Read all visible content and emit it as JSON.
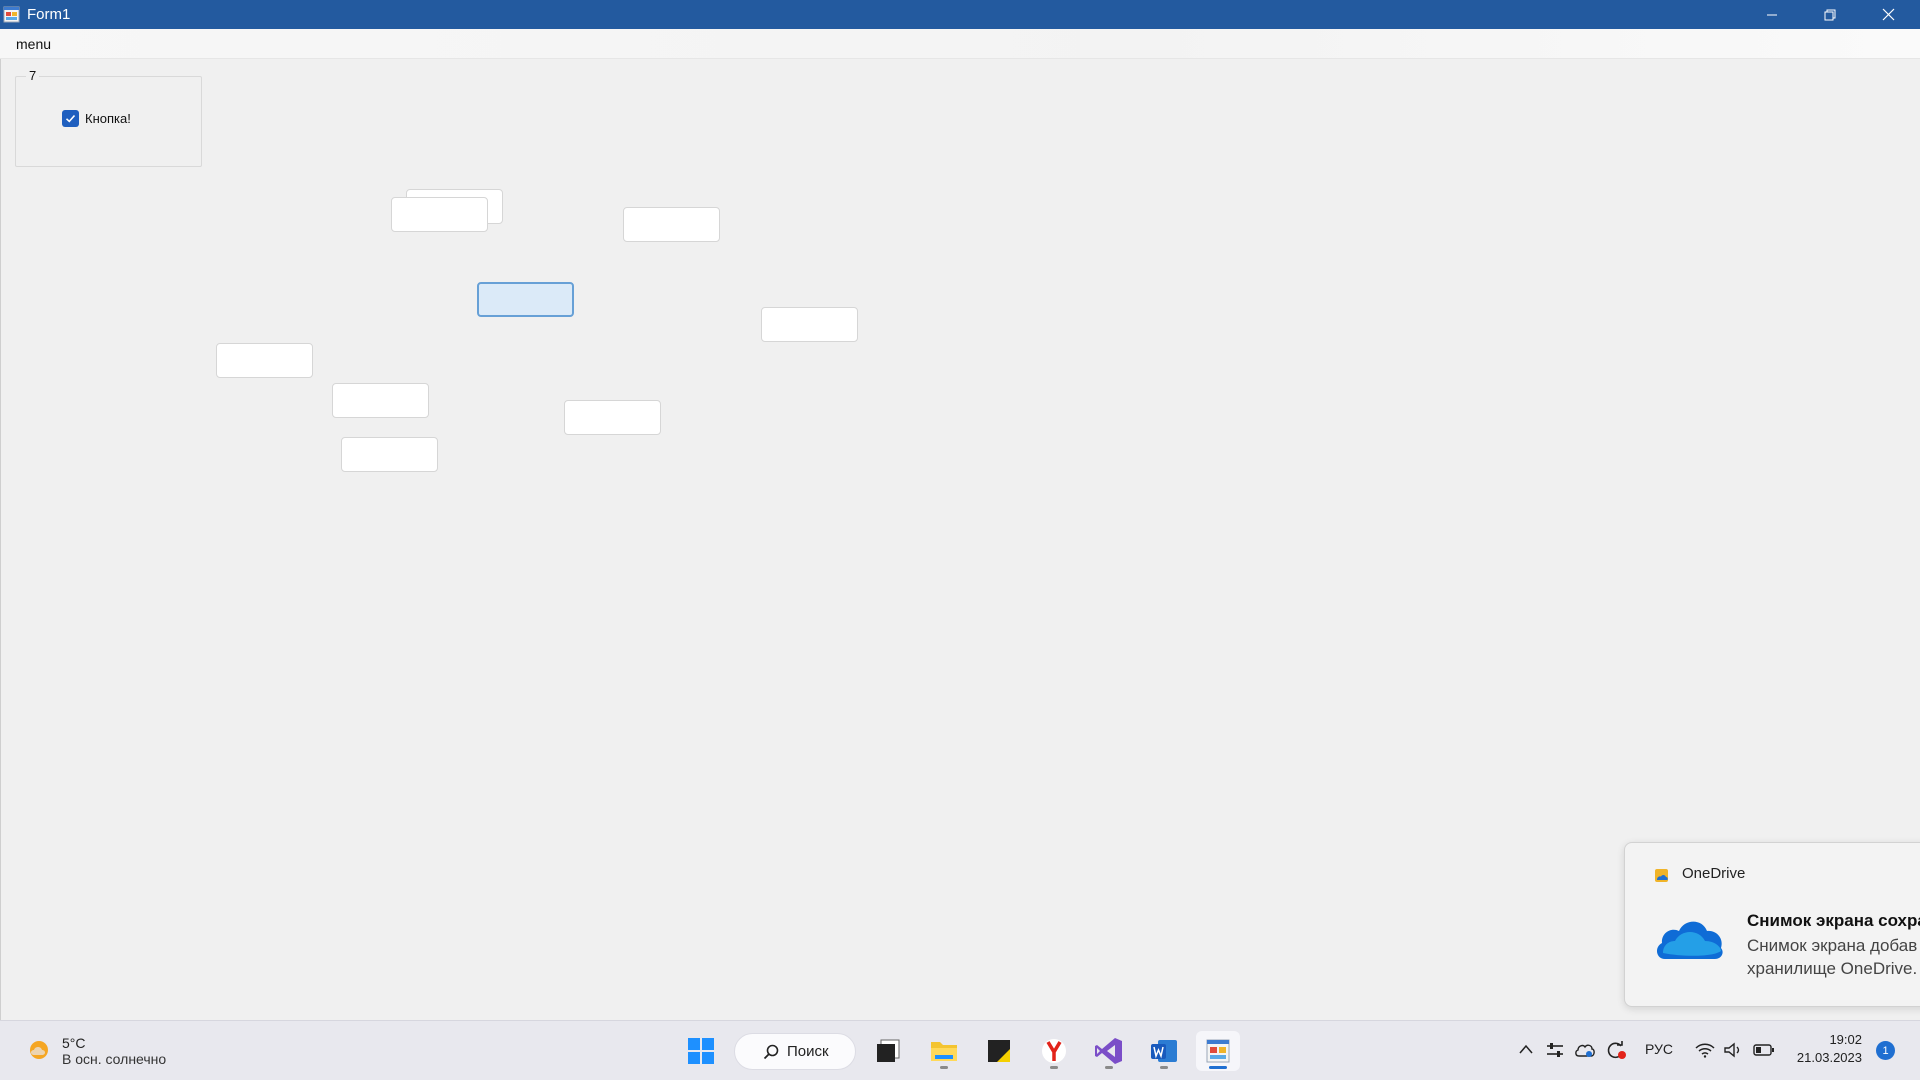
{
  "window": {
    "title": "Form1",
    "icons": {
      "app": "form-app-icon",
      "minimize": "minimize-icon",
      "restore": "restore-icon",
      "close": "close-icon"
    }
  },
  "menu": {
    "items": [
      {
        "label": "menu"
      }
    ]
  },
  "groupbox": {
    "title": "7",
    "checkbox": {
      "label": "Кнопка!",
      "checked": true
    }
  },
  "textboxes": [
    {
      "value": "",
      "focused": false
    },
    {
      "value": "",
      "focused": false
    },
    {
      "value": "",
      "focused": false
    },
    {
      "value": "",
      "focused": true
    },
    {
      "value": "",
      "focused": false
    },
    {
      "value": "",
      "focused": false
    },
    {
      "value": "",
      "focused": false
    },
    {
      "value": "",
      "focused": false
    },
    {
      "value": "",
      "focused": false
    }
  ],
  "toast": {
    "app": "OneDrive",
    "title": "Снимок экрана сохра",
    "line1": "Снимок экрана добав",
    "line2": "хранилище OneDrive."
  },
  "taskbar": {
    "weather": {
      "temp": "5°C",
      "condition": "В осн. солнечно"
    },
    "search_label": "Поиск",
    "apps": [
      "start-icon",
      "task-view-icon",
      "file-explorer-icon",
      "sticky-notes-icon",
      "yandex-browser-icon",
      "visual-studio-icon",
      "word-icon",
      "form-app-icon"
    ],
    "tray": {
      "language": "РУС",
      "time": "19:02",
      "date": "21.03.2023",
      "notifications": "1"
    }
  },
  "colors": {
    "titlebar": "#235a9f",
    "accent": "#1f6fd1",
    "focus_fill": "#dbeaf8",
    "focus_border": "#67a0d6"
  }
}
